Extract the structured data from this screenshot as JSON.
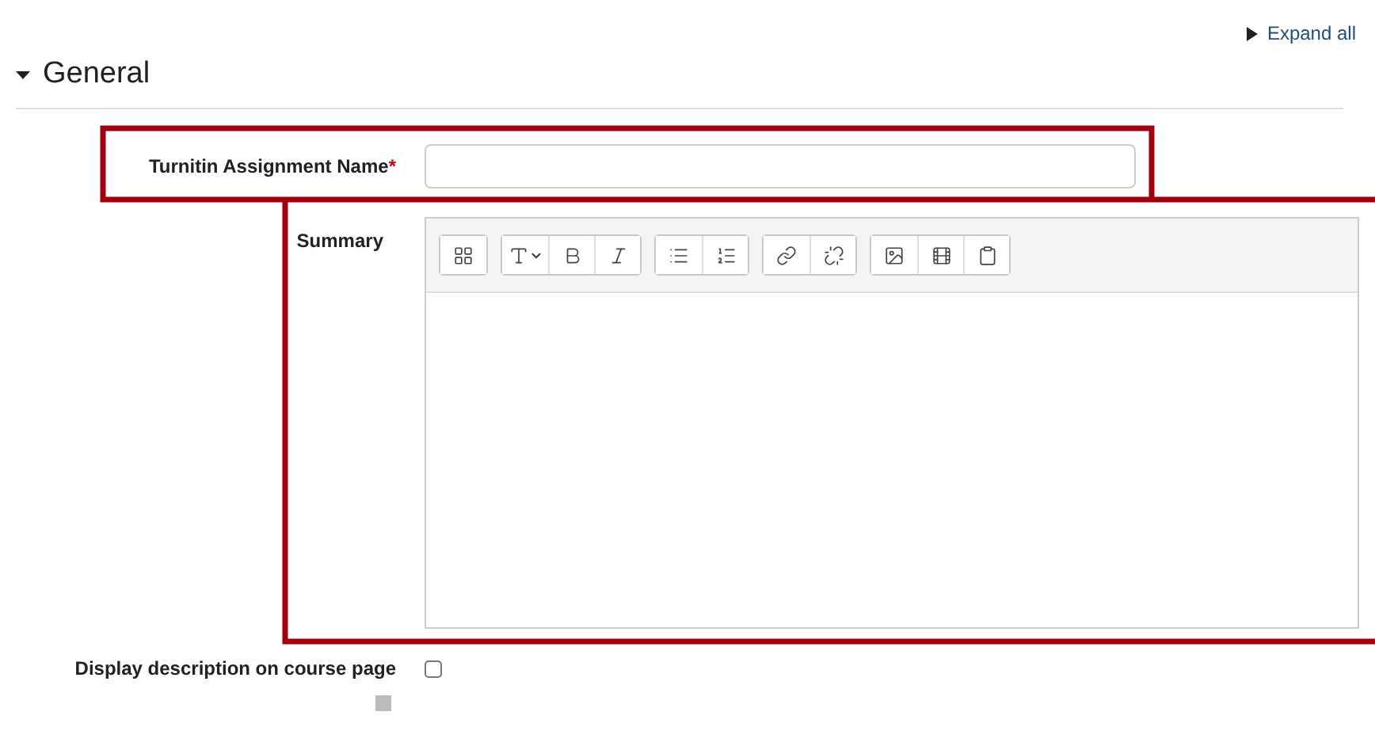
{
  "expand_all": {
    "label": "Expand all"
  },
  "section": {
    "title": "General",
    "expanded": true
  },
  "name_field": {
    "label": "Turnitin Assignment Name",
    "required_mark": "*"
  },
  "summary_field": {
    "label": "Summary"
  },
  "display_option": {
    "label": "Display description on course page",
    "checked": false
  }
}
